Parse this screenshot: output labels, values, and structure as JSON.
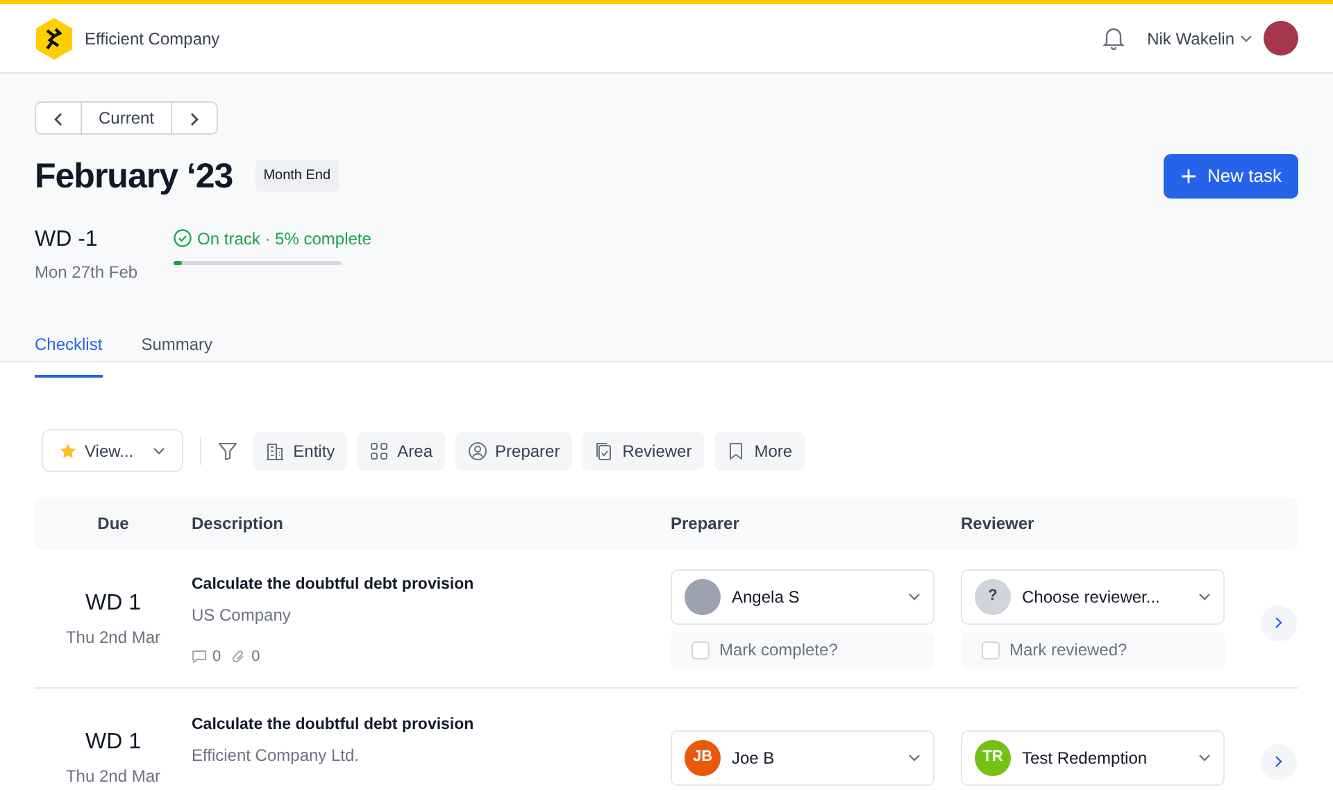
{
  "header": {
    "company": "Efficient Company",
    "user_name": "Nik Wakelin"
  },
  "period_nav": {
    "label": "Current"
  },
  "title": "February ‘23",
  "badge": "Month End",
  "workday": {
    "label": "WD -1",
    "date": "Mon 27th Feb"
  },
  "progress": {
    "text": "On track · 5% complete",
    "level": 0.05
  },
  "new_task_button": "New task",
  "tabs": [
    {
      "label": "Checklist",
      "selected": true
    },
    {
      "label": "Summary",
      "selected": false
    }
  ],
  "filters": {
    "view": "View...",
    "chips": [
      {
        "kind": "entity",
        "label": "Entity"
      },
      {
        "kind": "area",
        "label": "Area"
      },
      {
        "kind": "preparer",
        "label": "Preparer"
      },
      {
        "kind": "reviewer",
        "label": "Reviewer"
      },
      {
        "kind": "more",
        "label": "More"
      }
    ]
  },
  "table": {
    "columns": [
      "Due",
      "Description",
      "Preparer",
      "Reviewer"
    ],
    "rows": [
      {
        "due": "WD 1",
        "due_date": "Thu 2nd Mar",
        "task": "Calculate the doubtful debt provision",
        "entity": "US Company",
        "comments": "0",
        "attachments": "0",
        "preparer": {
          "kind": "photo",
          "name": "Angela S"
        },
        "preparer_check": {
          "label": "Mark complete?",
          "checked": false
        },
        "reviewer": {
          "kind": "unknown",
          "initials": "?",
          "name": "Choose reviewer..."
        },
        "reviewer_check": {
          "label": "Mark reviewed?",
          "checked": false
        }
      },
      {
        "due": "WD 1",
        "due_date": "Thu 2nd Mar",
        "task": "Calculate the doubtful debt provision",
        "entity": "Efficient Company Ltd.",
        "preparer": {
          "kind": "initials",
          "initials": "JB",
          "name": "Joe B",
          "color": "#e8590c"
        },
        "reviewer": {
          "kind": "initials",
          "initials": "TR",
          "name": "Test Redemption",
          "color": "#74c116"
        }
      }
    ]
  }
}
